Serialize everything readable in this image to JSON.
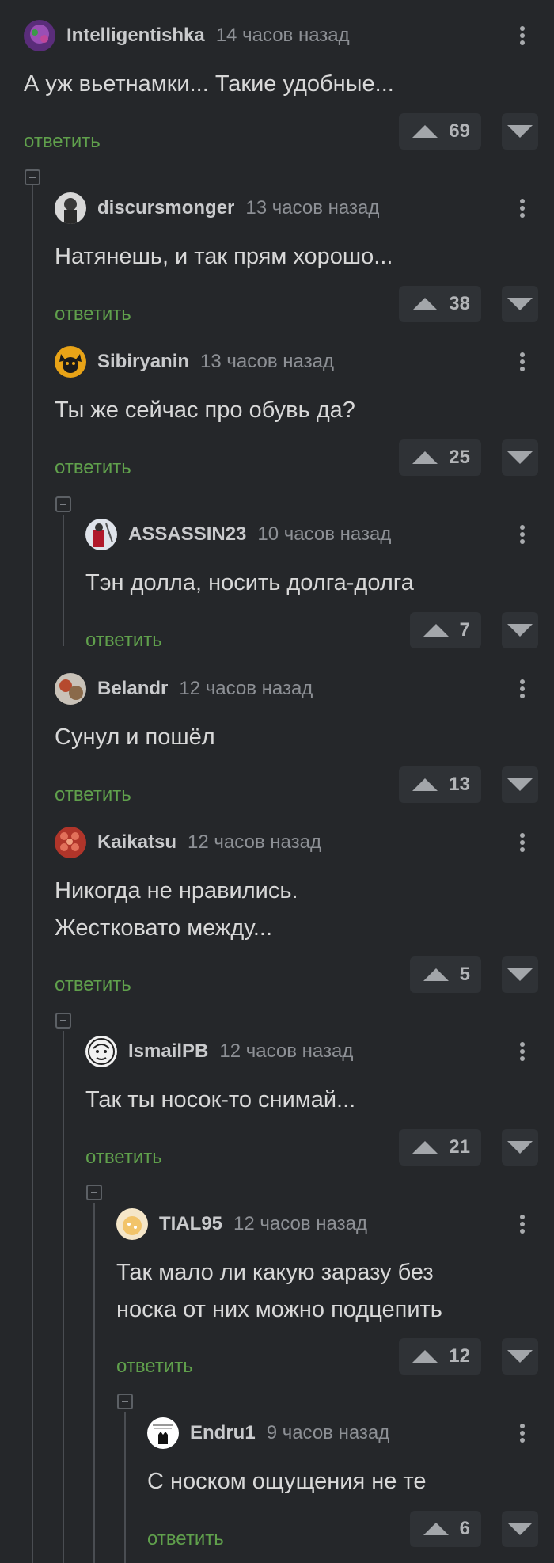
{
  "reply_label": "ответить",
  "comments": [
    {
      "username": "Intelligentishka",
      "time": "14 часов назад",
      "text": "А уж вьетнамки... Такие удобные...",
      "rating": "69"
    },
    {
      "username": "discursmonger",
      "time": "13 часов назад",
      "text": "Натянешь, и так прям хорошо...",
      "rating": "38"
    },
    {
      "username": "Sibiryanin",
      "time": "13 часов назад",
      "text": "Ты же сейчас про обувь да?",
      "rating": "25"
    },
    {
      "username": "ASSASSIN23",
      "time": "10 часов назад",
      "text": "Тэн долла, носить долга-долга",
      "rating": "7"
    },
    {
      "username": "Belandr",
      "time": "12 часов назад",
      "text": "Сунул и пошёл",
      "rating": "13"
    },
    {
      "username": "Kaikatsu",
      "time": "12 часов назад",
      "text": "Никогда не нравились.\nЖестковато между...",
      "rating": "5"
    },
    {
      "username": "IsmailPB",
      "time": "12 часов назад",
      "text": "Так ты носок-то снимай...",
      "rating": "21"
    },
    {
      "username": "TIAL95",
      "time": "12 часов назад",
      "text": "Так мало ли какую заразу без\nноска от них можно подцепить",
      "rating": "12"
    },
    {
      "username": "Endru1",
      "time": "9 часов назад",
      "text": "С носком ощущения не те",
      "rating": "6"
    }
  ],
  "colors": {
    "background": "#25272a",
    "reply_link": "#60a04c",
    "username": "#c9cacc",
    "timestamp": "#8d9095",
    "thread_line": "#4a4d52",
    "rating_box": "#2f3236"
  },
  "icons": {
    "more": "vertical-ellipsis-icon",
    "upvote": "upvote-arrow-icon",
    "downvote": "downvote-arrow-icon",
    "collapse": "collapse-branch-icon"
  }
}
